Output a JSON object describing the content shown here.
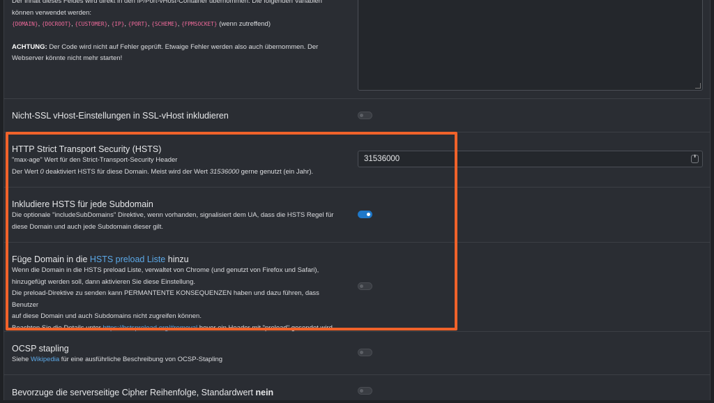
{
  "top_setting": {
    "desc_line1": "Der Inhalt dieses Feldes wird direkt in den IP/Port-vHost-Container übernommen. Die folgenden Variablen",
    "desc_line2": "können verwendet werden:",
    "variables": [
      "{DOMAIN}",
      "{DOCROOT}",
      "{CUSTOMER}",
      "{IP}",
      "{PORT}",
      "{SCHEME}",
      "{FPMSOCKET}"
    ],
    "variables_suffix": "(wenn zutreffend)",
    "warning_label": "ACHTUNG:",
    "warning_line1": "Der Code wird nicht auf Fehler geprüft. Etwaige Fehler werden also auch übernommen. Der",
    "warning_line2": "Webserver könnte nicht mehr starten!",
    "textarea_value": ""
  },
  "settings": {
    "nonssl": {
      "title": "Nicht-SSL vHost-Einstellungen in SSL-vHost inkludieren",
      "enabled": false
    },
    "hsts": {
      "title": "HTTP Strict Transport Security (HSTS)",
      "line1": "\"max-age\" Wert für den Strict-Transport-Security Header",
      "line2_a": "Der Wert ",
      "line2_zero": "0",
      "line2_b": " deaktiviert HSTS für diese Domain. Meist wird der Wert ",
      "line2_value": "31536000",
      "line2_c": " gerne genutzt (ein Jahr).",
      "value": "31536000",
      "spinner_symbol": "⬍"
    },
    "hsts_subdomains": {
      "title": "Inkludiere HSTS für jede Subdomain",
      "line1": "Die optionale \"includeSubDomains\" Direktive, wenn vorhanden, signalisiert dem UA, dass die HSTS Regel für",
      "line2": "diese Domain und auch jede Subdomain dieser gilt.",
      "enabled": true
    },
    "hsts_preload": {
      "title_a": "Füge Domain in die ",
      "title_link": "HSTS preload Liste",
      "title_b": " hinzu",
      "line1": "Wenn die Domain in die HSTS preload Liste, verwaltet von Chrome (und genutzt von Firefox und Safari),",
      "line2": "hinzugefügt werden soll, dann aktivieren Sie diese Einstellung.",
      "line3": "Die preload-Direktive zu senden kann PERMANTENTE KONSEQUENZEN haben und dazu führen, dass Benutzer",
      "line4": "auf diese Domain und auch Subdomains nicht zugreifen können.",
      "line5_a": "Beachten Sie die Details unter ",
      "line5_link": "https://hstspreload.org/#removal",
      "line5_b": " bevor ein Header mit \"preload\" gesendet wird.",
      "enabled": false
    },
    "ocsp": {
      "title": "OCSP stapling",
      "desc_a": "Siehe ",
      "desc_link": "Wikipedia",
      "desc_b": " für eine ausführliche Beschreibung von OCSP-Stapling",
      "enabled": false
    },
    "cipher": {
      "title_a": "Bevorzuge die serverseitige Cipher Reihenfolge, Standardwert ",
      "title_bold": "nein",
      "enabled": false
    }
  },
  "colors": {
    "highlight": "#f0622a",
    "link": "#5ca9e8",
    "toggle_on": "#1f78c8",
    "variable": "#f06a9b"
  }
}
